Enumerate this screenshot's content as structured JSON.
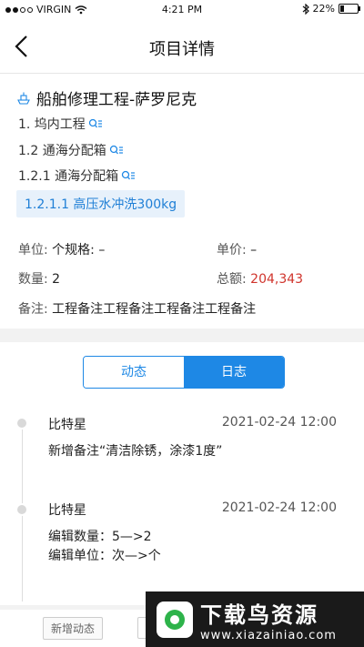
{
  "status_bar": {
    "carrier": "VIRGIN",
    "time": "4:21 PM",
    "battery_percent": "22%",
    "battery_level": 0.22
  },
  "nav": {
    "title": "项目详情"
  },
  "project": {
    "title": "船舶修理工程-萨罗尼克",
    "path": [
      {
        "label": "1. 坞内工程"
      },
      {
        "label": "1.2 通海分配箱"
      },
      {
        "label": "1.2.1 通海分配箱"
      }
    ],
    "selected_item": "1.2.1.1 高压水冲洗300kg",
    "unit_label": "单位:",
    "unit_value": "个规格: –",
    "price_label": "单价:",
    "price_value": "–",
    "qty_label": "数量:",
    "qty_value": "2",
    "total_label": "总额:",
    "total_value": "204,343",
    "remark_label": "备注:",
    "remark_value": "工程备注工程备注工程备注工程备注"
  },
  "tabs": {
    "dynamic": "动态",
    "log": "日志"
  },
  "log_entries": [
    {
      "user": "比特星",
      "time": "2021-02-24 12:00",
      "lines": [
        "新增备注“清洁除锈，涂漆1度”"
      ]
    },
    {
      "user": "比特星",
      "time": "2021-02-24 12:00",
      "lines": [
        "编辑数量：5—>2",
        "编辑单位：次—>个"
      ]
    }
  ],
  "bottom": {
    "add_dynamic": "新增动态"
  },
  "watermark": {
    "title": "下载鸟资源",
    "url": "www.xiazainiao.com"
  }
}
